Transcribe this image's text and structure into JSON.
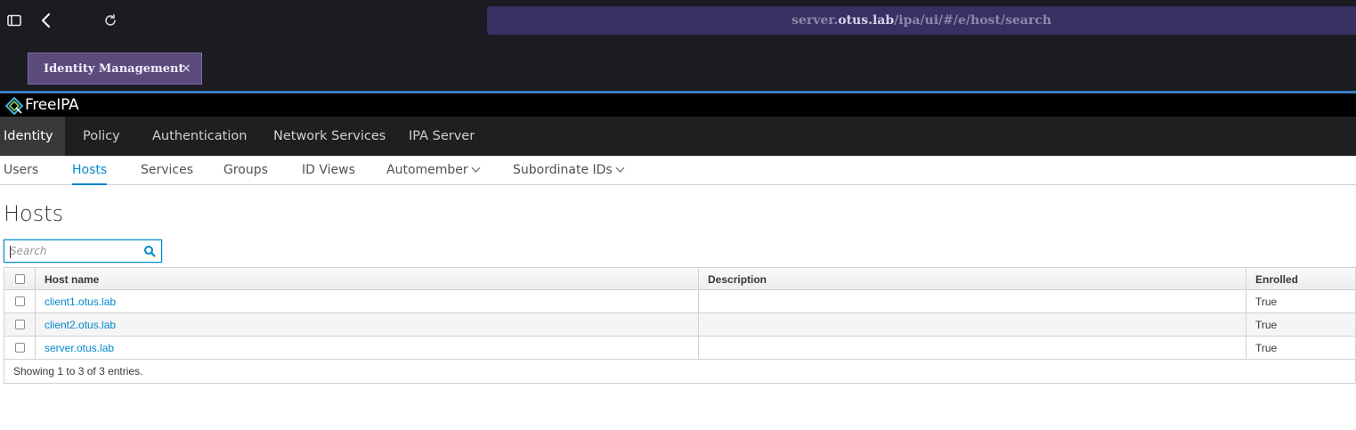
{
  "browser": {
    "url_host": "server.",
    "url_domain": "otus.lab",
    "url_path": "/ipa/ui/#/e/host/search",
    "tab_title": "Identity Management",
    "tab_close": "×"
  },
  "app": {
    "brand": "FreeIPA"
  },
  "nav": {
    "items": [
      "Identity",
      "Policy",
      "Authentication",
      "Network Services",
      "IPA Server"
    ],
    "active": "Identity"
  },
  "subnav": {
    "items": [
      "Users",
      "Hosts",
      "Services",
      "Groups",
      "ID Views",
      "Automember",
      "Subordinate IDs"
    ],
    "active": "Hosts"
  },
  "page": {
    "title": "Hosts"
  },
  "search": {
    "placeholder": "Search",
    "value": ""
  },
  "table": {
    "headers": {
      "host_name": "Host name",
      "description": "Description",
      "enrolled": "Enrolled"
    },
    "rows": [
      {
        "host_name": "client1.otus.lab",
        "description": "",
        "enrolled": "True"
      },
      {
        "host_name": "client2.otus.lab",
        "description": "",
        "enrolled": "True"
      },
      {
        "host_name": "server.otus.lab",
        "description": "",
        "enrolled": "True"
      }
    ],
    "footer": "Showing 1 to 3 of 3 entries."
  },
  "colors": {
    "accent": "#0088ce",
    "url_bar": "#3a2f63",
    "tab_bg": "#5b4a7c",
    "nav_bg": "#1f1f1f"
  }
}
